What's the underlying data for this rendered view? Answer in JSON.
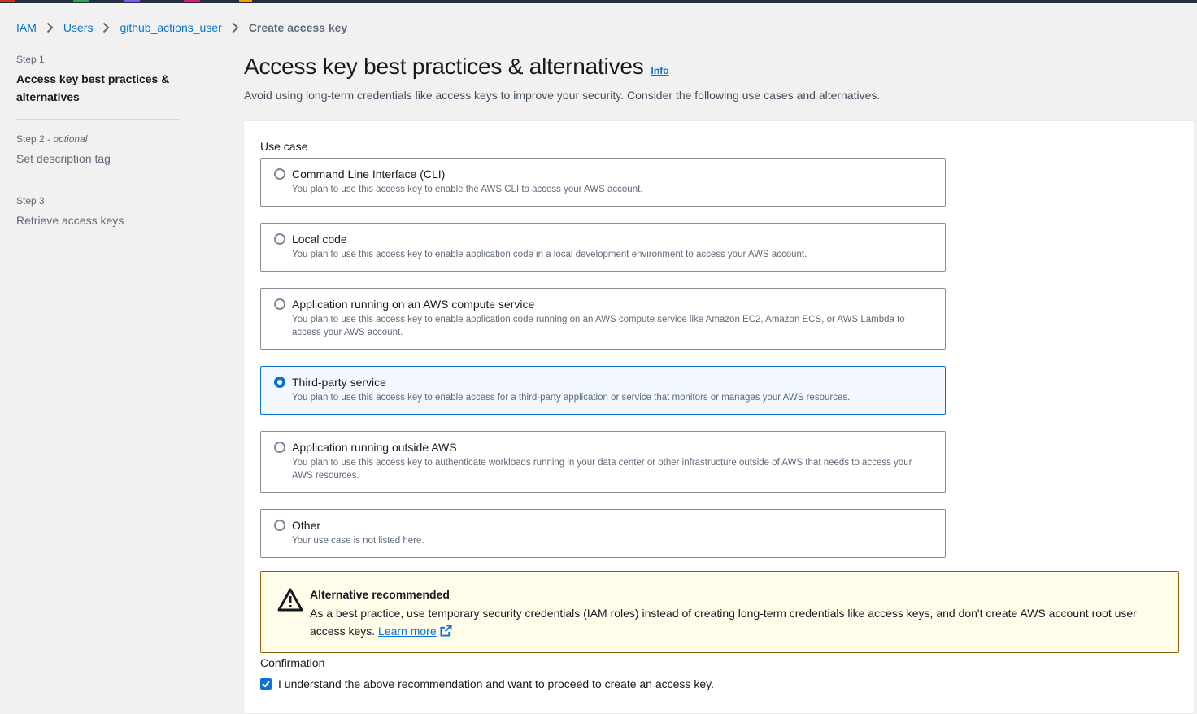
{
  "breadcrumb": {
    "items": [
      "IAM",
      "Users",
      "github_actions_user"
    ],
    "current": "Create access key"
  },
  "steps": [
    {
      "label": "Step 1",
      "title": "Access key best practices & alternatives"
    },
    {
      "label": "Step 2",
      "optional": "optional",
      "title": "Set description tag"
    },
    {
      "label": "Step 3",
      "title": "Retrieve access keys"
    }
  ],
  "header": {
    "title": "Access key best practices & alternatives",
    "info": "Info",
    "subtitle": "Avoid using long-term credentials like access keys to improve your security. Consider the following use cases and alternatives."
  },
  "use_case": {
    "label": "Use case",
    "selected": "Third-party service",
    "options": [
      {
        "title": "Command Line Interface (CLI)",
        "desc": "You plan to use this access key to enable the AWS CLI to access your AWS account."
      },
      {
        "title": "Local code",
        "desc": "You plan to use this access key to enable application code in a local development environment to access your AWS account."
      },
      {
        "title": "Application running on an AWS compute service",
        "desc": "You plan to use this access key to enable application code running on an AWS compute service like Amazon EC2, Amazon ECS, or AWS Lambda to access your AWS account."
      },
      {
        "title": "Third-party service",
        "desc": "You plan to use this access key to enable access for a third-party application or service that monitors or manages your AWS resources."
      },
      {
        "title": "Application running outside AWS",
        "desc": "You plan to use this access key to authenticate workloads running in your data center or other infrastructure outside of AWS that needs to access your AWS resources."
      },
      {
        "title": "Other",
        "desc": "Your use case is not listed here."
      }
    ]
  },
  "alert": {
    "title": "Alternative recommended",
    "body": "As a best practice, use temporary security credentials (IAM roles) instead of creating long-term credentials like access keys, and don't create AWS account root user access keys.",
    "link": "Learn more"
  },
  "confirmation": {
    "label": "Confirmation",
    "checkbox_label": "I understand the above recommendation and want to proceed to create an access key.",
    "checked": true
  },
  "colors": {
    "link": "#0972d3",
    "selected_bg": "#f2f8fd",
    "alert_bg": "#fffce9",
    "alert_border": "#8d6605"
  }
}
